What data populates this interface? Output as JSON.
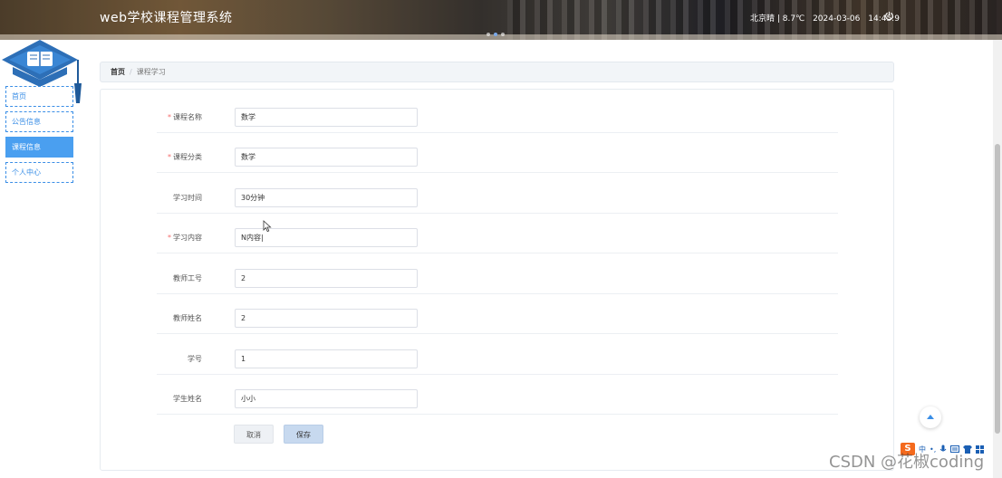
{
  "header": {
    "title": "web学校课程管理系统",
    "weather": "北京晴 | 8.7℃",
    "date": "2024-03-06",
    "time": "14:45:9"
  },
  "sidebar": {
    "items": [
      {
        "label": "首页"
      },
      {
        "label": "公告信息"
      },
      {
        "label": "课程信息"
      },
      {
        "label": "个人中心"
      }
    ]
  },
  "breadcrumb": {
    "home": "首页",
    "separator": "/",
    "current": "课程学习"
  },
  "form": {
    "fields": [
      {
        "label": "课程名称",
        "required": "*",
        "value": "数学"
      },
      {
        "label": "课程分类",
        "required": "*",
        "value": "数学"
      },
      {
        "label": "学习时间",
        "value": "30分钟"
      },
      {
        "label": "学习内容",
        "required": "*",
        "value": "N内容|"
      },
      {
        "label": "教师工号",
        "value": "2"
      },
      {
        "label": "教师姓名",
        "value": "2"
      },
      {
        "label": "学号",
        "value": "1"
      },
      {
        "label": "学生姓名",
        "value": "小小"
      }
    ],
    "cancel_label": "取消",
    "save_label": "保存"
  },
  "tray": {
    "logo": "S",
    "lang": "中",
    "punct": "•,"
  },
  "watermark": "CSDN @花椒coding",
  "colors": {
    "accent": "#3a8ee6",
    "active_bg": "#4a9ff0",
    "required": "#f56c6c",
    "save_button": "#c7d9ef"
  },
  "icons": [
    "power-icon",
    "book-icon",
    "arrow-up-icon",
    "mic-icon",
    "keyboard-icon",
    "shirt-icon",
    "grid-icon"
  ]
}
